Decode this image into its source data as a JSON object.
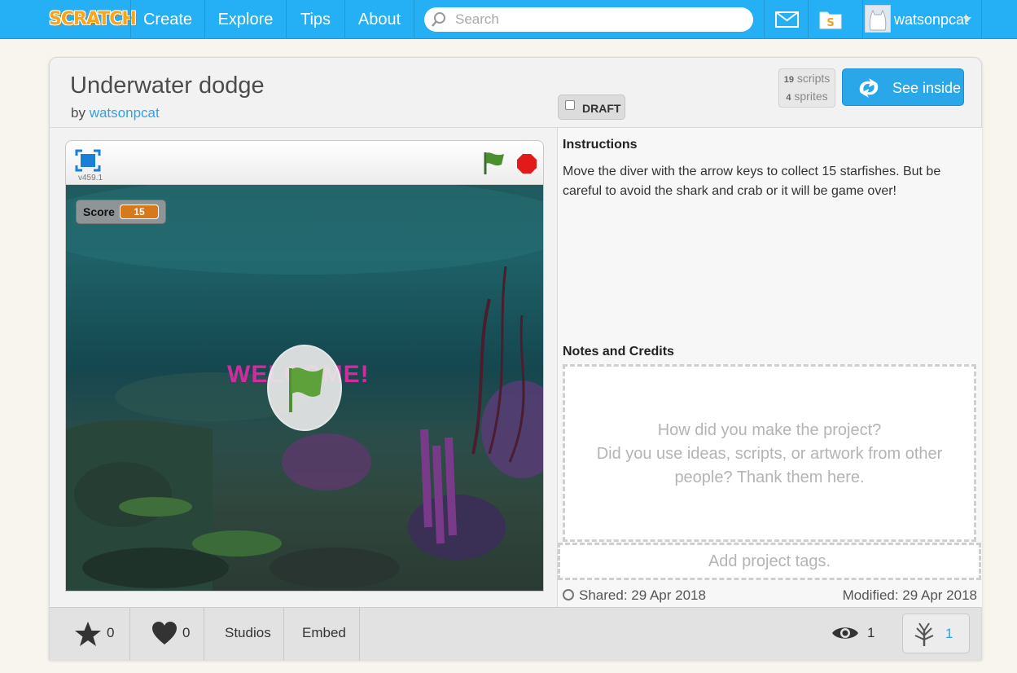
{
  "nav": {
    "logo": "SCRATCH",
    "links": [
      "Create",
      "Explore",
      "Tips",
      "About"
    ],
    "search_placeholder": "Search",
    "username": "watsonpcat"
  },
  "project": {
    "title": "Underwater dodge",
    "by_label": "by",
    "author": "watsonpcat",
    "draft_label": "DRAFT",
    "scripts_count": "19",
    "scripts_label": "scripts",
    "sprites_count": "4",
    "sprites_label": "sprites",
    "see_inside_label": "See inside"
  },
  "player": {
    "version": "v459.1",
    "score_label": "Score",
    "score_value": "15",
    "welcome_text": "WELCOME!"
  },
  "instructions": {
    "heading": "Instructions",
    "text": "Move the diver with the arrow keys to collect 15 starfishes. But be careful to avoid the shark and crab or it will be game over!"
  },
  "notes": {
    "heading": "Notes and Credits",
    "placeholder_line1": "How did you make the project?",
    "placeholder_line2": "Did you use ideas, scripts, or artwork from other",
    "placeholder_line3": "people? Thank them here."
  },
  "tags": {
    "placeholder": "Add project tags."
  },
  "dates": {
    "shared": "Shared: 29 Apr 2018",
    "modified": "Modified: 29 Apr 2018"
  },
  "footer": {
    "favorites": "0",
    "loves": "0",
    "studios_label": "Studios",
    "embed_label": "Embed",
    "views": "1",
    "remixes": "1"
  },
  "colors": {
    "nav_bg": "#25aff4",
    "accent": "#2aa7e8",
    "welcome": "#d12b9d",
    "score_badge": "#d6791c"
  }
}
